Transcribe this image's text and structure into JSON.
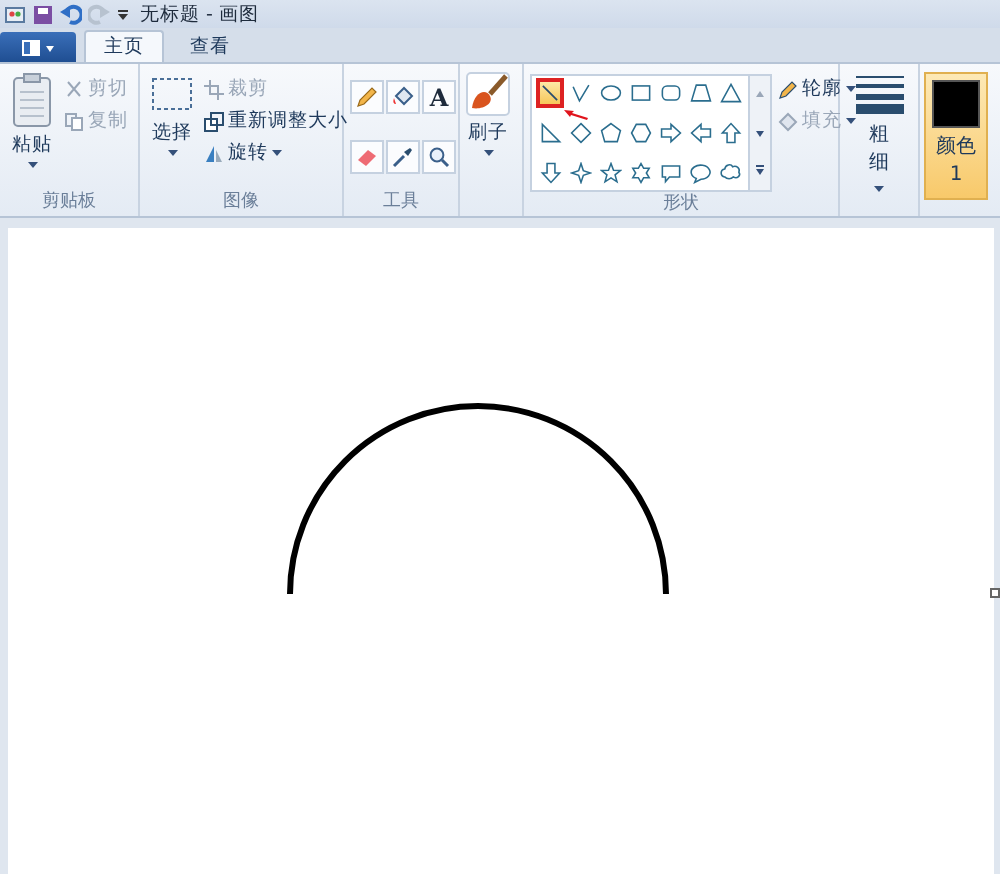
{
  "title_bar": {
    "title": "无标题 - 画图"
  },
  "tabs": [
    {
      "label": "主页",
      "selected": true
    },
    {
      "label": "查看",
      "selected": false
    }
  ],
  "clipboard": {
    "paste": "粘贴",
    "cut": {
      "label": "剪切",
      "disabled": true
    },
    "copy": {
      "label": "复制",
      "disabled": true
    },
    "label": "剪贴板"
  },
  "image": {
    "select": "选择",
    "crop": {
      "label": "裁剪",
      "disabled": true
    },
    "resize": {
      "label": "重新调整大小",
      "disabled": false
    },
    "rotate": {
      "label": "旋转",
      "disabled": false
    },
    "label": "图像"
  },
  "tools": {
    "text_tool": "A",
    "label": "工具"
  },
  "brushes": {
    "label": "刷子"
  },
  "shapes": {
    "label": "形状",
    "outline": {
      "label": "轮廓",
      "disabled": false
    },
    "fill": {
      "label": "填充",
      "disabled": true
    },
    "items": [
      {
        "kind": "line",
        "selected": true
      },
      {
        "kind": "curve",
        "selected": false
      },
      {
        "kind": "oval",
        "selected": false
      },
      {
        "kind": "rectangle",
        "selected": false
      },
      {
        "kind": "rounded-rectangle",
        "selected": false
      },
      {
        "kind": "polygon",
        "selected": false
      },
      {
        "kind": "triangle",
        "selected": false
      },
      {
        "kind": "right-triangle",
        "selected": false
      },
      {
        "kind": "diamond",
        "selected": false
      },
      {
        "kind": "pentagon",
        "selected": false
      },
      {
        "kind": "hexagon",
        "selected": false
      },
      {
        "kind": "right-arrow",
        "selected": false
      },
      {
        "kind": "left-arrow",
        "selected": false
      },
      {
        "kind": "up-arrow",
        "selected": false
      },
      {
        "kind": "down-arrow",
        "selected": false
      },
      {
        "kind": "four-point-star",
        "selected": false
      },
      {
        "kind": "five-point-star",
        "selected": false
      },
      {
        "kind": "six-point-star",
        "selected": false
      },
      {
        "kind": "rect-callout",
        "selected": false
      },
      {
        "kind": "oval-callout",
        "selected": false
      },
      {
        "kind": "cloud-callout",
        "selected": false
      }
    ]
  },
  "size": {
    "label": "粗细"
  },
  "color1": {
    "label": "颜色 1",
    "color": "#000000",
    "selected": true
  }
}
